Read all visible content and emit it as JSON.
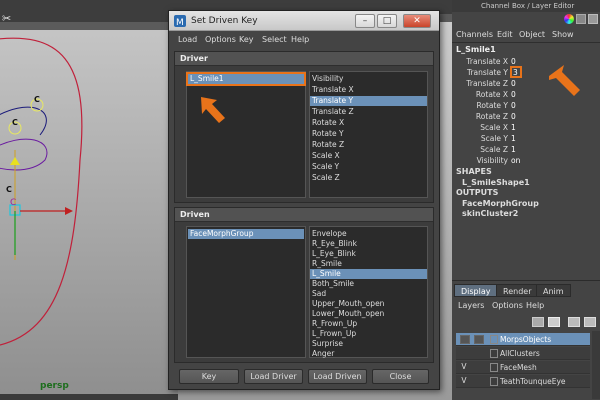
{
  "viewport": {
    "camera_label": "persp",
    "control_labels": [
      "C",
      "C",
      "C"
    ]
  },
  "channel_box": {
    "title": "Channel Box / Layer Editor",
    "menu": [
      "Channels",
      "Edit",
      "Object",
      "Show"
    ],
    "node_name": "L_Smile1",
    "attributes": [
      {
        "label": "Translate X",
        "value": "0"
      },
      {
        "label": "Translate Y",
        "value": "3"
      },
      {
        "label": "Translate Z",
        "value": "0"
      },
      {
        "label": "Rotate X",
        "value": "0"
      },
      {
        "label": "Rotate Y",
        "value": "0"
      },
      {
        "label": "Rotate Z",
        "value": "0"
      },
      {
        "label": "Scale X",
        "value": "1"
      },
      {
        "label": "Scale Y",
        "value": "1"
      },
      {
        "label": "Scale Z",
        "value": "1"
      },
      {
        "label": "Visibility",
        "value": "on"
      }
    ],
    "shapes_label": "SHAPES",
    "shapes": [
      "L_SmileShape1"
    ],
    "outputs_label": "OUTPUTS",
    "outputs": [
      "FaceMorphGroup",
      "skinCluster2"
    ]
  },
  "layer_editor": {
    "tabs": [
      "Display",
      "Render",
      "Anim"
    ],
    "active_tab": "Display",
    "menu": [
      "Layers",
      "Options",
      "Help"
    ],
    "layers": [
      {
        "v": "",
        "p": "",
        "name": "MorpsObjects",
        "selected": true
      },
      {
        "v": "",
        "p": "",
        "name": "AllClusters",
        "selected": false
      },
      {
        "v": "V",
        "p": "",
        "name": "FaceMesh",
        "selected": false
      },
      {
        "v": "V",
        "p": "",
        "name": "TeathTounqueEye",
        "selected": false
      }
    ]
  },
  "dialog": {
    "title": "Set Driven Key",
    "menu": [
      "Load",
      "Options",
      "Key",
      "Select",
      "Help"
    ],
    "driver_label": "Driver",
    "driver_objects": [
      "L_Smile1"
    ],
    "driver_attributes": [
      "Visibility",
      "Translate X",
      "Translate Y",
      "Translate Z",
      "Rotate X",
      "Rotate Y",
      "Rotate Z",
      "Scale X",
      "Scale Y",
      "Scale Z"
    ],
    "driver_selected_attribute": "Translate Y",
    "driven_label": "Driven",
    "driven_objects": [
      "FaceMorphGroup"
    ],
    "driven_attributes": [
      "Envelope",
      "R_Eye_Blink",
      "L_Eye_Blink",
      "R_Smile",
      "L_Smile",
      "Both_Smile",
      "Sad",
      "Upper_Mouth_open",
      "Lower_Mouth_open",
      "R_Frown_Up",
      "L_Frown_Up",
      "Surprise",
      "Anger"
    ],
    "driven_selected_attribute": "L_Smile",
    "buttons": {
      "key": "Key",
      "load_driver": "Load Driver",
      "load_driven": "Load Driven",
      "close": "Close"
    }
  },
  "colors": {
    "highlight": "#6b91b8",
    "annotation": "#e8731a",
    "background": "#444444"
  }
}
